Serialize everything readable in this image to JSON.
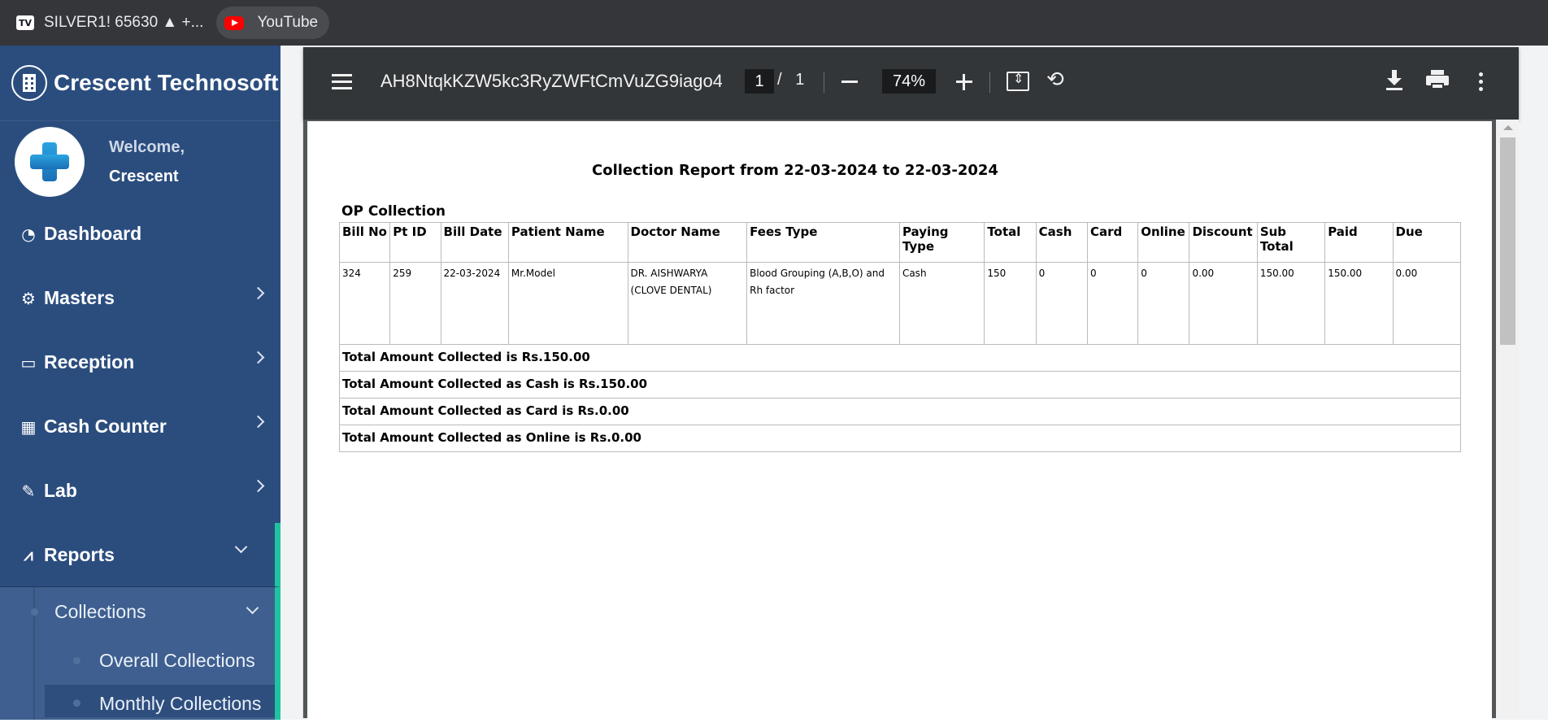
{
  "browser": {
    "tabs": [
      {
        "label": "SILVER1! 65630 ▲ +...",
        "icon": "tradingview-icon"
      },
      {
        "label": "YouTube",
        "icon": "youtube-icon"
      }
    ]
  },
  "sidebar": {
    "brand": "Crescent Technosoft",
    "welcome": "Welcome,",
    "user_name": "Crescent",
    "items": [
      {
        "label": "Dashboard",
        "icon": "dashboard-icon"
      },
      {
        "label": "Masters",
        "icon": "gears-icon"
      },
      {
        "label": "Reception",
        "icon": "monitor-icon"
      },
      {
        "label": "Cash Counter",
        "icon": "cash-register-icon"
      },
      {
        "label": "Lab",
        "icon": "test-tube-icon"
      },
      {
        "label": "Reports",
        "icon": "chart-line-icon"
      }
    ],
    "submenu": {
      "collections": "Collections",
      "overall": "Overall Collections",
      "monthly": "Monthly Collections"
    },
    "accent_color": "#1fc3a0"
  },
  "viewer": {
    "doc_title": "AH8NtqkKZW5kc3RyZWFtCmVuZG9iago4...",
    "current_page": "1",
    "page_separator": "/",
    "total_pages": "1",
    "zoom": "74%"
  },
  "report": {
    "title": "Collection Report from 22-03-2024 to 22-03-2024",
    "section": "OP Collection",
    "columns": [
      "Bill No",
      "Pt ID",
      "Bill Date",
      "Patient Name",
      "Doctor Name",
      "Fees Type",
      "Paying Type",
      "Total",
      "Cash",
      "Card",
      "Online",
      "Discount",
      "Sub Total",
      "Paid",
      "Due"
    ],
    "rows": [
      [
        "324",
        "259",
        "22-03-2024",
        "Mr.Model",
        "DR. AISHWARYA (CLOVE DENTAL)",
        "Blood Grouping (A,B,O) and Rh factor",
        "Cash",
        "150",
        "0",
        "0",
        "0",
        "0.00",
        "150.00",
        "150.00",
        "0.00"
      ]
    ],
    "totals": [
      "Total Amount Collected is Rs.150.00",
      "Total Amount Collected  as Cash is Rs.150.00",
      "Total Amount Collected  as Card is Rs.0.00",
      "Total Amount Collected  as Online is Rs.0.00"
    ]
  }
}
